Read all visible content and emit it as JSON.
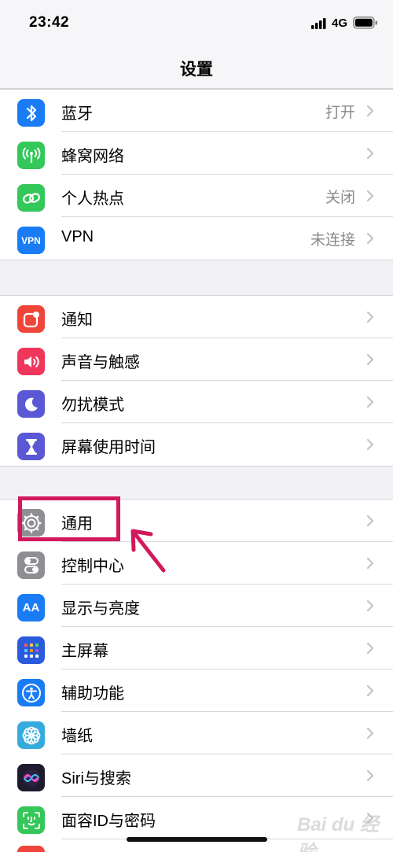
{
  "status": {
    "time": "23:42",
    "network": "4G"
  },
  "nav": {
    "title": "设置"
  },
  "groups": [
    [
      {
        "label": "蓝牙",
        "value": "打开",
        "icon": "bluetooth-icon",
        "color": "#1a7cf5"
      },
      {
        "label": "蜂窝网络",
        "value": "",
        "icon": "cellular-icon",
        "color": "#34c759"
      },
      {
        "label": "个人热点",
        "value": "关闭",
        "icon": "hotspot-icon",
        "color": "#34c759"
      },
      {
        "label": "VPN",
        "value": "未连接",
        "icon": "vpn-icon",
        "color": "#1a7cf5",
        "icon_text": "VPN"
      }
    ],
    [
      {
        "label": "通知",
        "value": "",
        "icon": "notifications-icon",
        "color": "#f0453a"
      },
      {
        "label": "声音与触感",
        "value": "",
        "icon": "sound-icon",
        "color": "#f0365b"
      },
      {
        "label": "勿扰模式",
        "value": "",
        "icon": "moon-icon",
        "color": "#5b58d6"
      },
      {
        "label": "屏幕使用时间",
        "value": "",
        "icon": "hourglass-icon",
        "color": "#5b58d6"
      }
    ],
    [
      {
        "label": "通用",
        "value": "",
        "icon": "gear-icon",
        "color": "#8e8e93"
      },
      {
        "label": "控制中心",
        "value": "",
        "icon": "switches-icon",
        "color": "#8e8e93"
      },
      {
        "label": "显示与亮度",
        "value": "",
        "icon": "display-icon",
        "color": "#1a7cf5",
        "icon_text": "AA"
      },
      {
        "label": "主屏幕",
        "value": "",
        "icon": "home-screen-icon",
        "color": "#2a5bdc"
      },
      {
        "label": "辅助功能",
        "value": "",
        "icon": "accessibility-icon",
        "color": "#1a7cf5"
      },
      {
        "label": "墙纸",
        "value": "",
        "icon": "wallpaper-icon",
        "color": "#36aadc"
      },
      {
        "label": "Siri与搜索",
        "value": "",
        "icon": "siri-icon",
        "color": "#1c1c2e"
      },
      {
        "label": "面容ID与密码",
        "value": "",
        "icon": "faceid-icon",
        "color": "#34c759"
      }
    ]
  ],
  "watermark": "Bai du 经验"
}
